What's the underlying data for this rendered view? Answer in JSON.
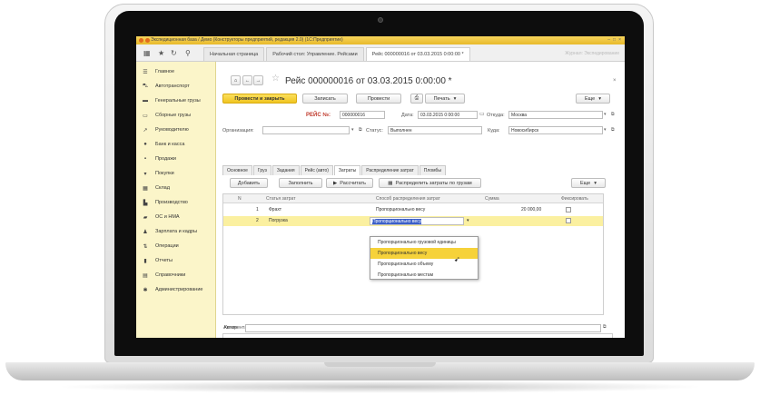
{
  "window": {
    "title": "Экспедиционная база / Демо (Конструкторы предприятий, редакция 2.0) (1С:Предприятие)"
  },
  "tabs": [
    {
      "label": "Начальная страница"
    },
    {
      "label": "Рабочий стол: Управление. Рейсами"
    },
    {
      "label": "Рейс 000000016 от 03.03.2015 0:00:00 *"
    }
  ],
  "tabs_faded": "Журнал: Экспедирование",
  "sidebar": {
    "items": [
      {
        "label": "Главное",
        "icon": "menu-icon",
        "glyph": "☰"
      },
      {
        "label": "Автотранспорт",
        "icon": "car-icon",
        "glyph": "⛍"
      },
      {
        "label": "Генеральные грузы",
        "icon": "truck-icon",
        "glyph": "▬"
      },
      {
        "label": "Сборные грузы",
        "icon": "bus-icon",
        "glyph": "▭"
      },
      {
        "label": "Руководителю",
        "icon": "chart-icon",
        "glyph": "↗"
      },
      {
        "label": "Банк и касса",
        "icon": "coin-icon",
        "glyph": "●"
      },
      {
        "label": "Продажи",
        "icon": "bag-icon",
        "glyph": "▪"
      },
      {
        "label": "Покупки",
        "icon": "cart-icon",
        "glyph": "▾"
      },
      {
        "label": "Склад",
        "icon": "warehouse-icon",
        "glyph": "▦"
      },
      {
        "label": "Производство",
        "icon": "factory-icon",
        "glyph": "▙"
      },
      {
        "label": "ОС и НМА",
        "icon": "assets-icon",
        "glyph": "▰"
      },
      {
        "label": "Зарплата и кадры",
        "icon": "people-icon",
        "glyph": "♟"
      },
      {
        "label": "Операции",
        "icon": "operations-icon",
        "glyph": "⇅"
      },
      {
        "label": "Отчеты",
        "icon": "reports-icon",
        "glyph": "▮"
      },
      {
        "label": "Справочники",
        "icon": "book-icon",
        "glyph": "▤"
      },
      {
        "label": "Администрирование",
        "icon": "gear-icon",
        "glyph": "✱"
      }
    ]
  },
  "document": {
    "title": "Рейс 000000016 от 03.03.2015 0:00:00 *",
    "buttons": {
      "post_close": "Провести и закрыть",
      "save": "Записать",
      "post": "Провести",
      "print": "Печать",
      "more": "Еще"
    },
    "reis_label": "РЕЙС №:",
    "reis_no": "000000016",
    "date_label": "Дата:",
    "date_value": "03.03.2015 0:00:00",
    "from_label": "Откуда:",
    "from_value": "Москва",
    "org_label": "Организация:",
    "status_label": "Статус:",
    "status_value": "Выполнен",
    "to_label": "Куда:",
    "to_value": "Новосибирск"
  },
  "subtabs": [
    {
      "label": "Основное"
    },
    {
      "label": "Груз"
    },
    {
      "label": "Задания"
    },
    {
      "label": "Рейс (авто)"
    },
    {
      "label": "Затраты"
    },
    {
      "label": "Распределение затрат"
    },
    {
      "label": "Пломбы"
    }
  ],
  "table_toolbar": {
    "add": "Добавить",
    "fill": "Заполнить",
    "calc": "Рассчитать",
    "distribute": "Распределить затраты по грузам",
    "more": "Еще"
  },
  "table": {
    "headers": [
      "N",
      "Статья затрат",
      "Способ распределения затрат",
      "Сумма",
      "Фиксировать"
    ],
    "rows": [
      {
        "n": "1",
        "item": "Фрахт",
        "method": "Пропорционально весу",
        "sum": "20 000,00"
      },
      {
        "n": "2",
        "item": "Погрузка",
        "method": "Пропорционально весу",
        "sum": ""
      }
    ]
  },
  "dropdown": {
    "options": [
      "Пропорционально грузовой единицы",
      "Пропорционально весу",
      "Пропорционально объему",
      "Пропорционально местам"
    ],
    "highlighted": "Пропорционально весу"
  },
  "footer": {
    "comment_label": "Комментарий:",
    "author_label": "Автор:"
  }
}
